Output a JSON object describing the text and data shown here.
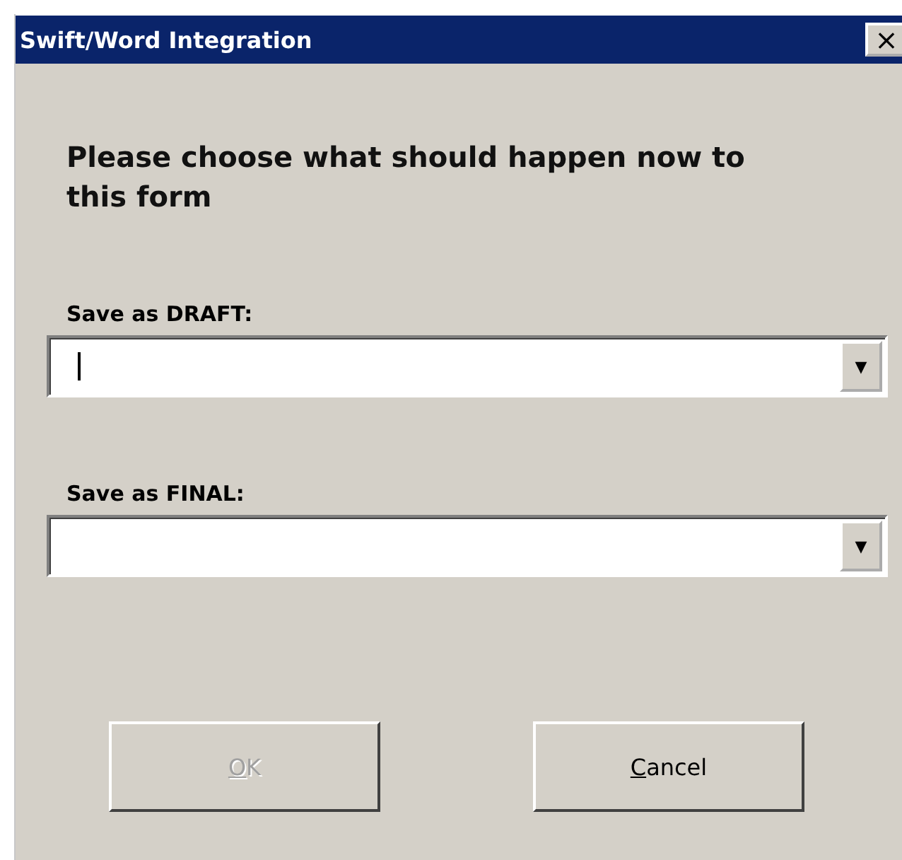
{
  "window": {
    "title": "Swift/Word Integration",
    "close_label": "×"
  },
  "prompt": "Please choose what should happen now to this form",
  "fields": [
    {
      "label": "Save as DRAFT:",
      "focused": true,
      "arrow": "▼"
    },
    {
      "label": "Save as FINAL:",
      "focused": false,
      "arrow": "▼"
    }
  ],
  "buttons": [
    {
      "key": "O",
      "rest": "K",
      "disabled": true
    },
    {
      "key": "C",
      "rest": "ancel",
      "disabled": false
    }
  ]
}
